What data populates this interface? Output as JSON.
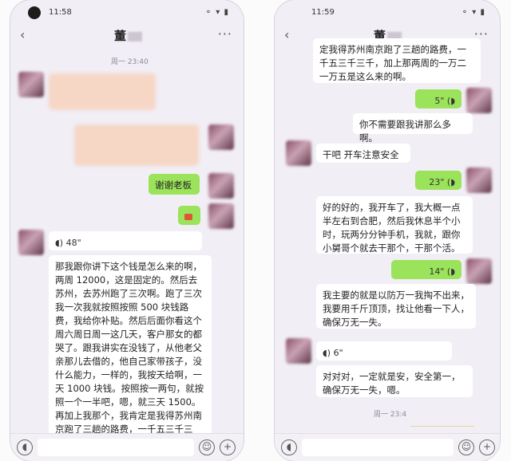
{
  "left_screen": {
    "status_time": "11:58",
    "status_right": "⚬ ▾ ▮",
    "title": "董",
    "timestamp": "周一 23:40",
    "thanks_msg": "谢谢老板",
    "voice_duration": "48\"",
    "long_msg": "那我跟你讲下这个钱是怎么来的啊，两周 12000，这是固定的。然后去苏州，去苏州跑了三次啊。跑了三次我一次我就按照按照 500 块钱路费，我给你补贴。然后后面你看这个周六周日周一这几天，客户那女的都哭了。跟我讲实在没钱了，从他老父亲那儿去借的，他自己家带孩子，没什么能力，一样的，我按天给啊，一天 1000 块钱。按照按一两句，就按照一个一半吧，嗯，就三天 1500。再加上我那个，我肯定是我得苏州南京跑了三趟的路费，一千五三千三千，加上那两周的一万"
  },
  "right_screen": {
    "status_time": "11:59",
    "status_right": "⚬ ▾ ▮",
    "title": "董",
    "top_msg": "定我得苏州南京跑了三趟的路费，一千五三千三千，加上那两周的一万二一万五是这么来的啊。",
    "voice1": "5\"",
    "msg_no_need": "你不需要跟我讲那么多啊。",
    "msg_drive": "干吧 开车注意安全",
    "voice2": "23\"",
    "msg_driving": "好的好的，我开车了，我大概一点半左右到合肥，然后我休息半个小时，玩两分分钟手机，我就，跟你小舅哥个就去干那个，干那个活。",
    "voice3": "14\"",
    "msg_prevent": "我主要的就是以防万一我掏不出来，我要用千斤顶顶，找让他看一下人，确保万无一失。",
    "voice4": "6\"",
    "msg_yes": "对对对，一定就是安，安全第一，确保万无一失，嗯。",
    "timestamp2": "周一 23:4"
  },
  "icons": [
    "back-arrow-icon",
    "more-icon",
    "voice-icon",
    "emoji-icon",
    "plus-icon"
  ]
}
